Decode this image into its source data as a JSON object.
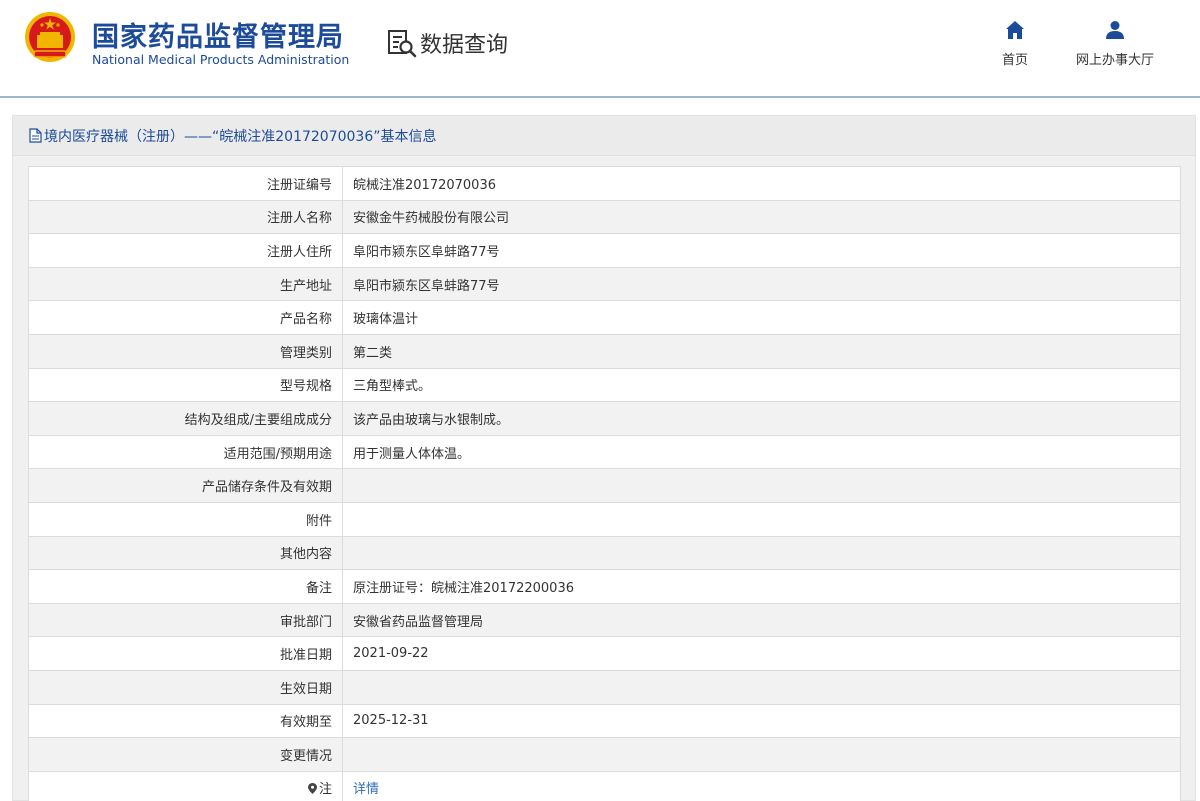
{
  "header": {
    "brand_cn": "国家药品监督管理局",
    "brand_en": "National Medical Products Administration",
    "section_label": "数据查询",
    "nav": [
      {
        "label": "首页",
        "icon": "home-icon"
      },
      {
        "label": "网上办事大厅",
        "icon": "user-icon"
      }
    ]
  },
  "panel": {
    "title": "境内医疗器械（注册）——“皖械注准20172070036”基本信息"
  },
  "rows": [
    {
      "label": "注册证编号",
      "value": "皖械注准20172070036"
    },
    {
      "label": "注册人名称",
      "value": "安徽金牛药械股份有限公司"
    },
    {
      "label": "注册人住所",
      "value": "阜阳市颍东区阜蚌路77号"
    },
    {
      "label": "生产地址",
      "value": "阜阳市颍东区阜蚌路77号"
    },
    {
      "label": "产品名称",
      "value": "玻璃体温计"
    },
    {
      "label": "管理类别",
      "value": "第二类"
    },
    {
      "label": "型号规格",
      "value": "三角型棒式。"
    },
    {
      "label": "结构及组成/主要组成成分",
      "value": "该产品由玻璃与水银制成。"
    },
    {
      "label": "适用范围/预期用途",
      "value": "用于测量人体体温。"
    },
    {
      "label": "产品储存条件及有效期",
      "value": ""
    },
    {
      "label": "附件",
      "value": ""
    },
    {
      "label": "其他内容",
      "value": ""
    },
    {
      "label": "备注",
      "value": "原注册证号：皖械注准20172200036"
    },
    {
      "label": "审批部门",
      "value": "安徽省药品监督管理局"
    },
    {
      "label": "批准日期",
      "value": "2021-09-22"
    },
    {
      "label": "生效日期",
      "value": ""
    },
    {
      "label": "有效期至",
      "value": "2025-12-31"
    },
    {
      "label": "变更情况",
      "value": ""
    }
  ],
  "note_row": {
    "label": "注",
    "link": "详情"
  },
  "colors": {
    "brand_blue": "#1c4b9a",
    "link_blue": "#2d6bb8",
    "emblem_red": "#d7191c",
    "emblem_gold": "#f2b500"
  }
}
